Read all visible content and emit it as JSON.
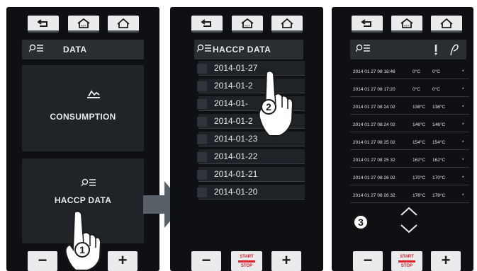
{
  "screen1": {
    "header_title": "DATA",
    "consumption_label": "CONSUMPTION",
    "haccp_label": "HACCP DATA",
    "step": "1"
  },
  "screen2": {
    "header_title": "HACCP DATA",
    "dates": [
      "2014-01-27",
      "2014-01-2",
      "2014-01-",
      "2014-01-2",
      "2014-01-23",
      "2014-01-22",
      "2014-01-21",
      "2014-01-20"
    ],
    "step": "2"
  },
  "screen3": {
    "col1_icon": "probe-icon",
    "col2_icon": "curve-icon",
    "rows": [
      {
        "time": "2014 01 27 08 16:46",
        "t1": "0°C",
        "t2": "0°C",
        "flag": "*"
      },
      {
        "time": "2014 01 27 08 17:20",
        "t1": "0°C",
        "t2": "0°C",
        "flag": "*"
      },
      {
        "time": "2014 01 27 08 24 02",
        "t1": "138°C",
        "t2": "138°C",
        "flag": "*"
      },
      {
        "time": "2014 01 27 08 24 02",
        "t1": "146°C",
        "t2": "146°C",
        "flag": "*"
      },
      {
        "time": "2014 01 27 08 25 02",
        "t1": "154°C",
        "t2": "154°C",
        "flag": "*"
      },
      {
        "time": "2014 01 27 08 25 32",
        "t1": "162°C",
        "t2": "162°C",
        "flag": "*"
      },
      {
        "time": "2014 01 27 08 26 02",
        "t1": "170°C",
        "t2": "170°C",
        "flag": "*"
      },
      {
        "time": "2014 01 27 08 26 32",
        "t1": "178°C",
        "t2": "178°C",
        "flag": "*"
      }
    ],
    "step": "3"
  },
  "bottom": {
    "minus": "−",
    "plus": "+",
    "start": "START",
    "stop": "STOP"
  },
  "colors": {
    "panel_bg": "#0e1013",
    "button_light": "#e9ebec",
    "start_stop_red": "#d9222a",
    "arrow_gray": "#5a6067"
  }
}
